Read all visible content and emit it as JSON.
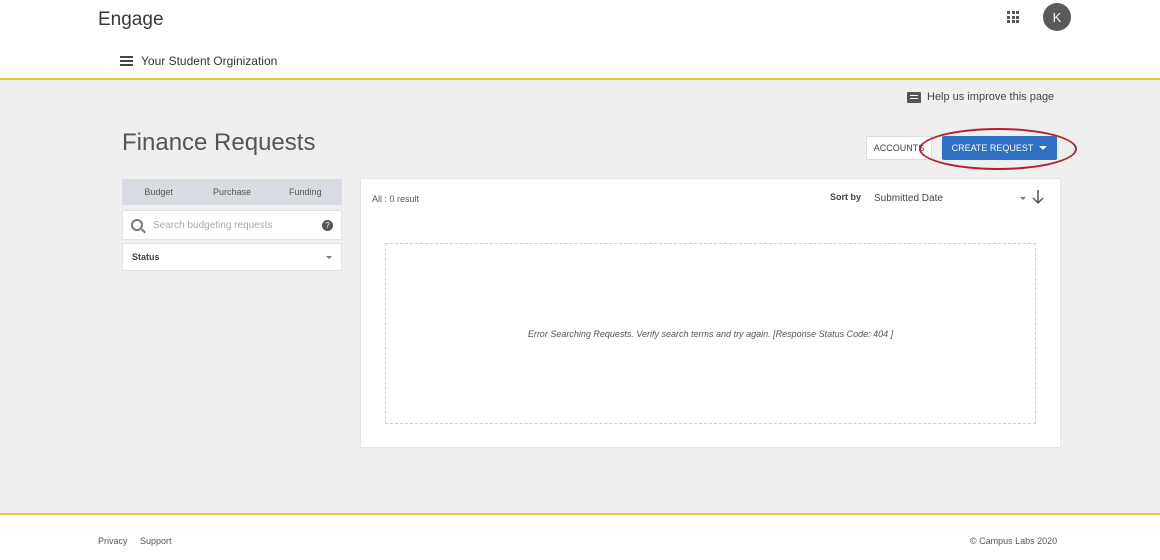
{
  "header": {
    "brand": "Engage",
    "org_name": "Your Student Orginization",
    "avatar_initial": "K"
  },
  "help": {
    "label": "Help us improve this page"
  },
  "page": {
    "title": "Finance Requests"
  },
  "actions": {
    "accounts_label": "ACCOUNTS",
    "create_label": "CREATE REQUEST",
    "highlight_color": "#b3222a",
    "create_color": "#2f6fc4"
  },
  "sidebar": {
    "tabs": [
      {
        "label": "Budget"
      },
      {
        "label": "Purchase"
      },
      {
        "label": "Funding"
      }
    ],
    "search": {
      "placeholder": "Search budgeting requests"
    },
    "status_filter": {
      "label": "Status"
    }
  },
  "results": {
    "count_label": "All : 0 result",
    "sort_label": "Sort by",
    "sort_value": "Submitted Date",
    "error_message": "Error Searching Requests. Verify search terms and try again. [Response Status Code: 404 ]"
  },
  "footer": {
    "links": [
      {
        "label": "Privacy"
      },
      {
        "label": "Support"
      }
    ],
    "copyright": "© Campus Labs 2020"
  },
  "colors": {
    "accent_line": "#e8c547"
  }
}
